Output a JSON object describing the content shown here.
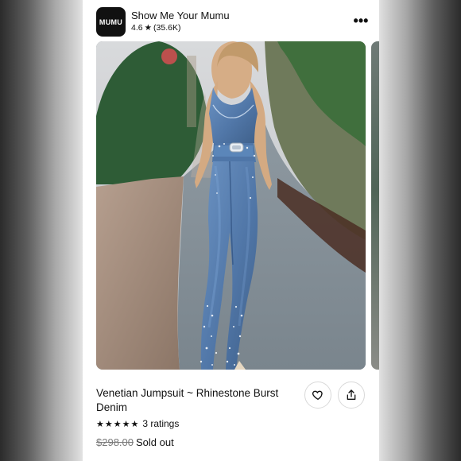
{
  "header": {
    "logo_text": "MUMU",
    "store_name": "Show Me Your Mumu",
    "rating": "4.6",
    "rating_icon": "star-icon",
    "review_count": "(35.6K)",
    "menu_icon": "more-icon"
  },
  "product": {
    "title": "Venetian Jumpsuit ~ Rhinestone Burst Denim",
    "stars": "★★★★★",
    "ratings_label": "3 ratings",
    "original_price": "$298.00",
    "status": "Sold out"
  },
  "actions": {
    "favorite_icon": "heart-icon",
    "share_icon": "share-icon"
  },
  "colors": {
    "background": "#f1f1f1",
    "card": "#ffffff",
    "text": "#111111",
    "muted_text": "#7a7a7a"
  }
}
